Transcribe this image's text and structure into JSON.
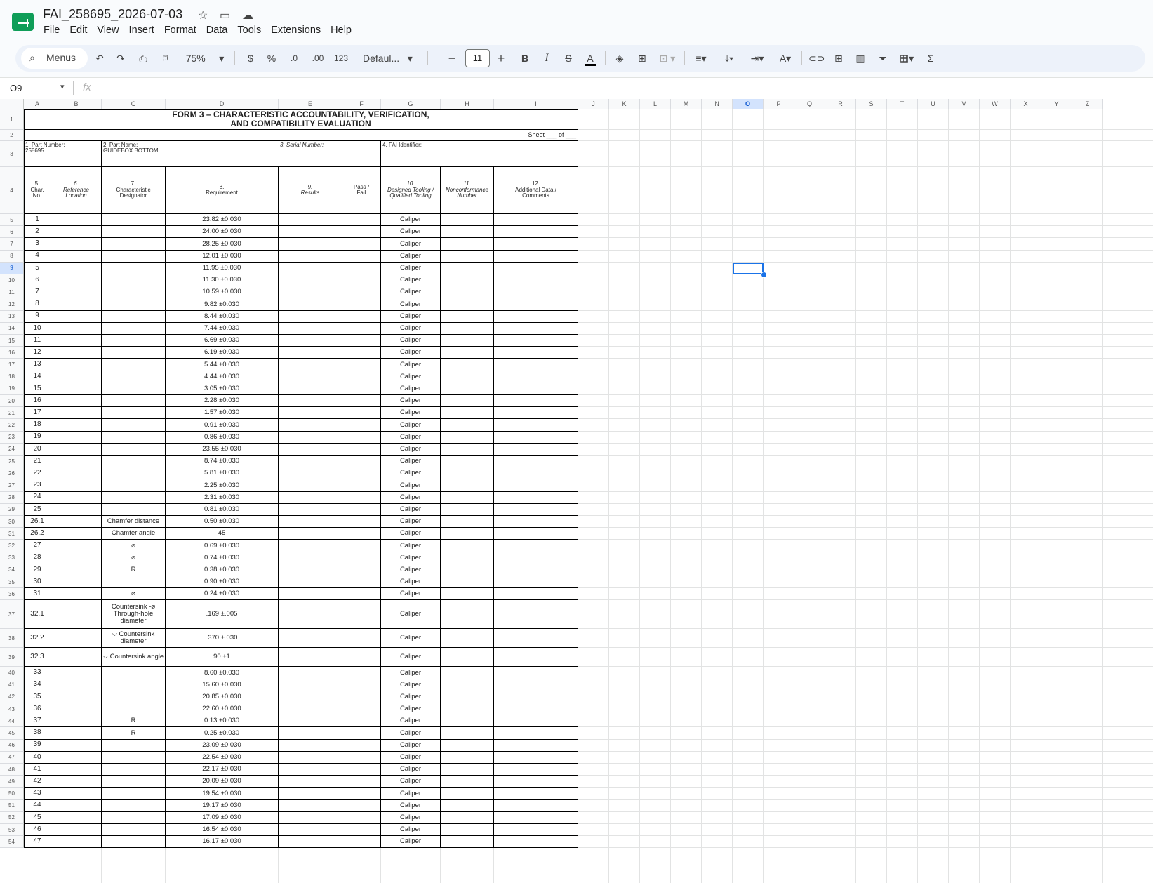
{
  "app": {
    "title": "FAI_258695_2026-07-03",
    "menus": [
      "File",
      "Edit",
      "View",
      "Insert",
      "Format",
      "Data",
      "Tools",
      "Extensions",
      "Help"
    ]
  },
  "toolbar": {
    "search_label": "Menus",
    "zoom": "75%",
    "currency": "$",
    "percent": "%",
    "dec_minus": ".0",
    "dec_plus": ".00",
    "number_format": "123",
    "font": "Defaul...",
    "font_size": "11",
    "minus": "−",
    "plus": "+",
    "bold": "B",
    "italic": "I",
    "sum": "Σ"
  },
  "formula_bar": {
    "cell_ref": "O9",
    "fx": "fx",
    "value": ""
  },
  "columns": [
    "A",
    "B",
    "C",
    "D",
    "E",
    "F",
    "G",
    "H",
    "I",
    "J",
    "K",
    "L",
    "M",
    "N",
    "O",
    "P",
    "Q",
    "R",
    "S",
    "T",
    "U",
    "V",
    "W",
    "X",
    "Y",
    "Z"
  ],
  "selected_cell": {
    "column": "O",
    "row": "9"
  },
  "form": {
    "title_line1": "FORM 3 – CHARACTERISTIC ACCOUNTABILITY, VERIFICATION,",
    "title_line2": "AND COMPATIBILITY EVALUATION",
    "sheet": "Sheet ___ of ___",
    "part_number_label": "1. Part Number:",
    "part_number": "258695",
    "part_name_label": "2. Part Name:",
    "part_name": "GUIDEBOX BOTTOM",
    "serial_label": "3. Serial Number:",
    "fai_label": "4. FAI Identifier:",
    "headers": {
      "a1": "5.",
      "a2": "Char.",
      "a3": "No.",
      "b1": "6.",
      "b2": "Reference",
      "b3": "Location",
      "c1": "7.",
      "c2": "Characteristic",
      "c3": "Designator",
      "d1": "8.",
      "d2": "Requirement",
      "e1": "9.",
      "e2": "Results",
      "f1": "Pass /",
      "f2": "Fail",
      "g1": "10.",
      "g2": "Designed Tooling /",
      "g3": "Qualified Tooling",
      "h1": "11.",
      "h2": "Nonconformance",
      "h3": "Number",
      "i1": "12.",
      "i2": "Additional Data /",
      "i3": "Comments"
    },
    "rows": [
      {
        "r": "5",
        "no": "1",
        "des": "",
        "req": "23.82 ±0.030",
        "tool": "Caliper"
      },
      {
        "r": "6",
        "no": "2",
        "des": "",
        "req": "24.00 ±0.030",
        "tool": "Caliper"
      },
      {
        "r": "7",
        "no": "3",
        "des": "",
        "req": "28.25 ±0.030",
        "tool": "Caliper"
      },
      {
        "r": "8",
        "no": "4",
        "des": "",
        "req": "12.01 ±0.030",
        "tool": "Caliper"
      },
      {
        "r": "9",
        "no": "5",
        "des": "",
        "req": "11.95 ±0.030",
        "tool": "Caliper"
      },
      {
        "r": "10",
        "no": "6",
        "des": "",
        "req": "11.30 ±0.030",
        "tool": "Caliper"
      },
      {
        "r": "11",
        "no": "7",
        "des": "",
        "req": "10.59 ±0.030",
        "tool": "Caliper"
      },
      {
        "r": "12",
        "no": "8",
        "des": "",
        "req": "9.82 ±0.030",
        "tool": "Caliper"
      },
      {
        "r": "13",
        "no": "9",
        "des": "",
        "req": "8.44 ±0.030",
        "tool": "Caliper"
      },
      {
        "r": "14",
        "no": "10",
        "des": "",
        "req": "7.44 ±0.030",
        "tool": "Caliper"
      },
      {
        "r": "15",
        "no": "11",
        "des": "",
        "req": "6.69 ±0.030",
        "tool": "Caliper"
      },
      {
        "r": "16",
        "no": "12",
        "des": "",
        "req": "6.19 ±0.030",
        "tool": "Caliper"
      },
      {
        "r": "17",
        "no": "13",
        "des": "",
        "req": "5.44 ±0.030",
        "tool": "Caliper"
      },
      {
        "r": "18",
        "no": "14",
        "des": "",
        "req": "4.44 ±0.030",
        "tool": "Caliper"
      },
      {
        "r": "19",
        "no": "15",
        "des": "",
        "req": "3.05 ±0.030",
        "tool": "Caliper"
      },
      {
        "r": "20",
        "no": "16",
        "des": "",
        "req": "2.28 ±0.030",
        "tool": "Caliper"
      },
      {
        "r": "21",
        "no": "17",
        "des": "",
        "req": "1.57 ±0.030",
        "tool": "Caliper"
      },
      {
        "r": "22",
        "no": "18",
        "des": "",
        "req": "0.91 ±0.030",
        "tool": "Caliper"
      },
      {
        "r": "23",
        "no": "19",
        "des": "",
        "req": "0.86 ±0.030",
        "tool": "Caliper"
      },
      {
        "r": "24",
        "no": "20",
        "des": "",
        "req": "23.55 ±0.030",
        "tool": "Caliper"
      },
      {
        "r": "25",
        "no": "21",
        "des": "",
        "req": "8.74 ±0.030",
        "tool": "Caliper"
      },
      {
        "r": "26",
        "no": "22",
        "des": "",
        "req": "5.81 ±0.030",
        "tool": "Caliper"
      },
      {
        "r": "27",
        "no": "23",
        "des": "",
        "req": "2.25 ±0.030",
        "tool": "Caliper"
      },
      {
        "r": "28",
        "no": "24",
        "des": "",
        "req": "2.31 ±0.030",
        "tool": "Caliper"
      },
      {
        "r": "29",
        "no": "25",
        "des": "",
        "req": "0.81 ±0.030",
        "tool": "Caliper"
      },
      {
        "r": "30",
        "no": "26.1",
        "des": "Chamfer distance",
        "req": "0.50 ±0.030",
        "tool": "Caliper"
      },
      {
        "r": "31",
        "no": "26.2",
        "des": "Chamfer angle",
        "req": "45",
        "tool": "Caliper"
      },
      {
        "r": "32",
        "no": "27",
        "des": "⌀",
        "req": "0.69 ±0.030",
        "tool": "Caliper"
      },
      {
        "r": "33",
        "no": "28",
        "des": "⌀",
        "req": "0.74 ±0.030",
        "tool": "Caliper"
      },
      {
        "r": "34",
        "no": "29",
        "des": "R",
        "req": "0.38 ±0.030",
        "tool": "Caliper"
      },
      {
        "r": "35",
        "no": "30",
        "des": "",
        "req": "0.90 ±0.030",
        "tool": "Caliper"
      },
      {
        "r": "36",
        "no": "31",
        "des": "⌀",
        "req": "0.24 ±0.030",
        "tool": "Caliper"
      },
      {
        "r": "37",
        "no": "32.1",
        "des": "Countersink -⌀ Through-hole diameter",
        "req": ".169 ±.005",
        "tool": "Caliper"
      },
      {
        "r": "38",
        "no": "32.2",
        "des": "⌵ Countersink diameter",
        "req": ".370 ±.030",
        "tool": "Caliper"
      },
      {
        "r": "39",
        "no": "32.3",
        "des": "⌵ Countersink angle",
        "req": "90 ±1",
        "tool": "Caliper"
      },
      {
        "r": "40",
        "no": "33",
        "des": "",
        "req": "8.60 ±0.030",
        "tool": "Caliper"
      },
      {
        "r": "41",
        "no": "34",
        "des": "",
        "req": "15.60 ±0.030",
        "tool": "Caliper"
      },
      {
        "r": "42",
        "no": "35",
        "des": "",
        "req": "20.85 ±0.030",
        "tool": "Caliper"
      },
      {
        "r": "43",
        "no": "36",
        "des": "",
        "req": "22.60 ±0.030",
        "tool": "Caliper"
      },
      {
        "r": "44",
        "no": "37",
        "des": "R",
        "req": "0.13 ±0.030",
        "tool": "Caliper"
      },
      {
        "r": "45",
        "no": "38",
        "des": "R",
        "req": "0.25 ±0.030",
        "tool": "Caliper"
      },
      {
        "r": "46",
        "no": "39",
        "des": "",
        "req": "23.09 ±0.030",
        "tool": "Caliper"
      },
      {
        "r": "47",
        "no": "40",
        "des": "",
        "req": "22.54 ±0.030",
        "tool": "Caliper"
      },
      {
        "r": "48",
        "no": "41",
        "des": "",
        "req": "22.17 ±0.030",
        "tool": "Caliper"
      },
      {
        "r": "49",
        "no": "42",
        "des": "",
        "req": "20.09 ±0.030",
        "tool": "Caliper"
      },
      {
        "r": "50",
        "no": "43",
        "des": "",
        "req": "19.54 ±0.030",
        "tool": "Caliper"
      },
      {
        "r": "51",
        "no": "44",
        "des": "",
        "req": "19.17 ±0.030",
        "tool": "Caliper"
      },
      {
        "r": "52",
        "no": "45",
        "des": "",
        "req": "17.09 ±0.030",
        "tool": "Caliper"
      },
      {
        "r": "53",
        "no": "46",
        "des": "",
        "req": "16.54 ±0.030",
        "tool": "Caliper"
      },
      {
        "r": "54",
        "no": "47",
        "des": "",
        "req": "16.17 ±0.030",
        "tool": "Caliper"
      }
    ]
  }
}
